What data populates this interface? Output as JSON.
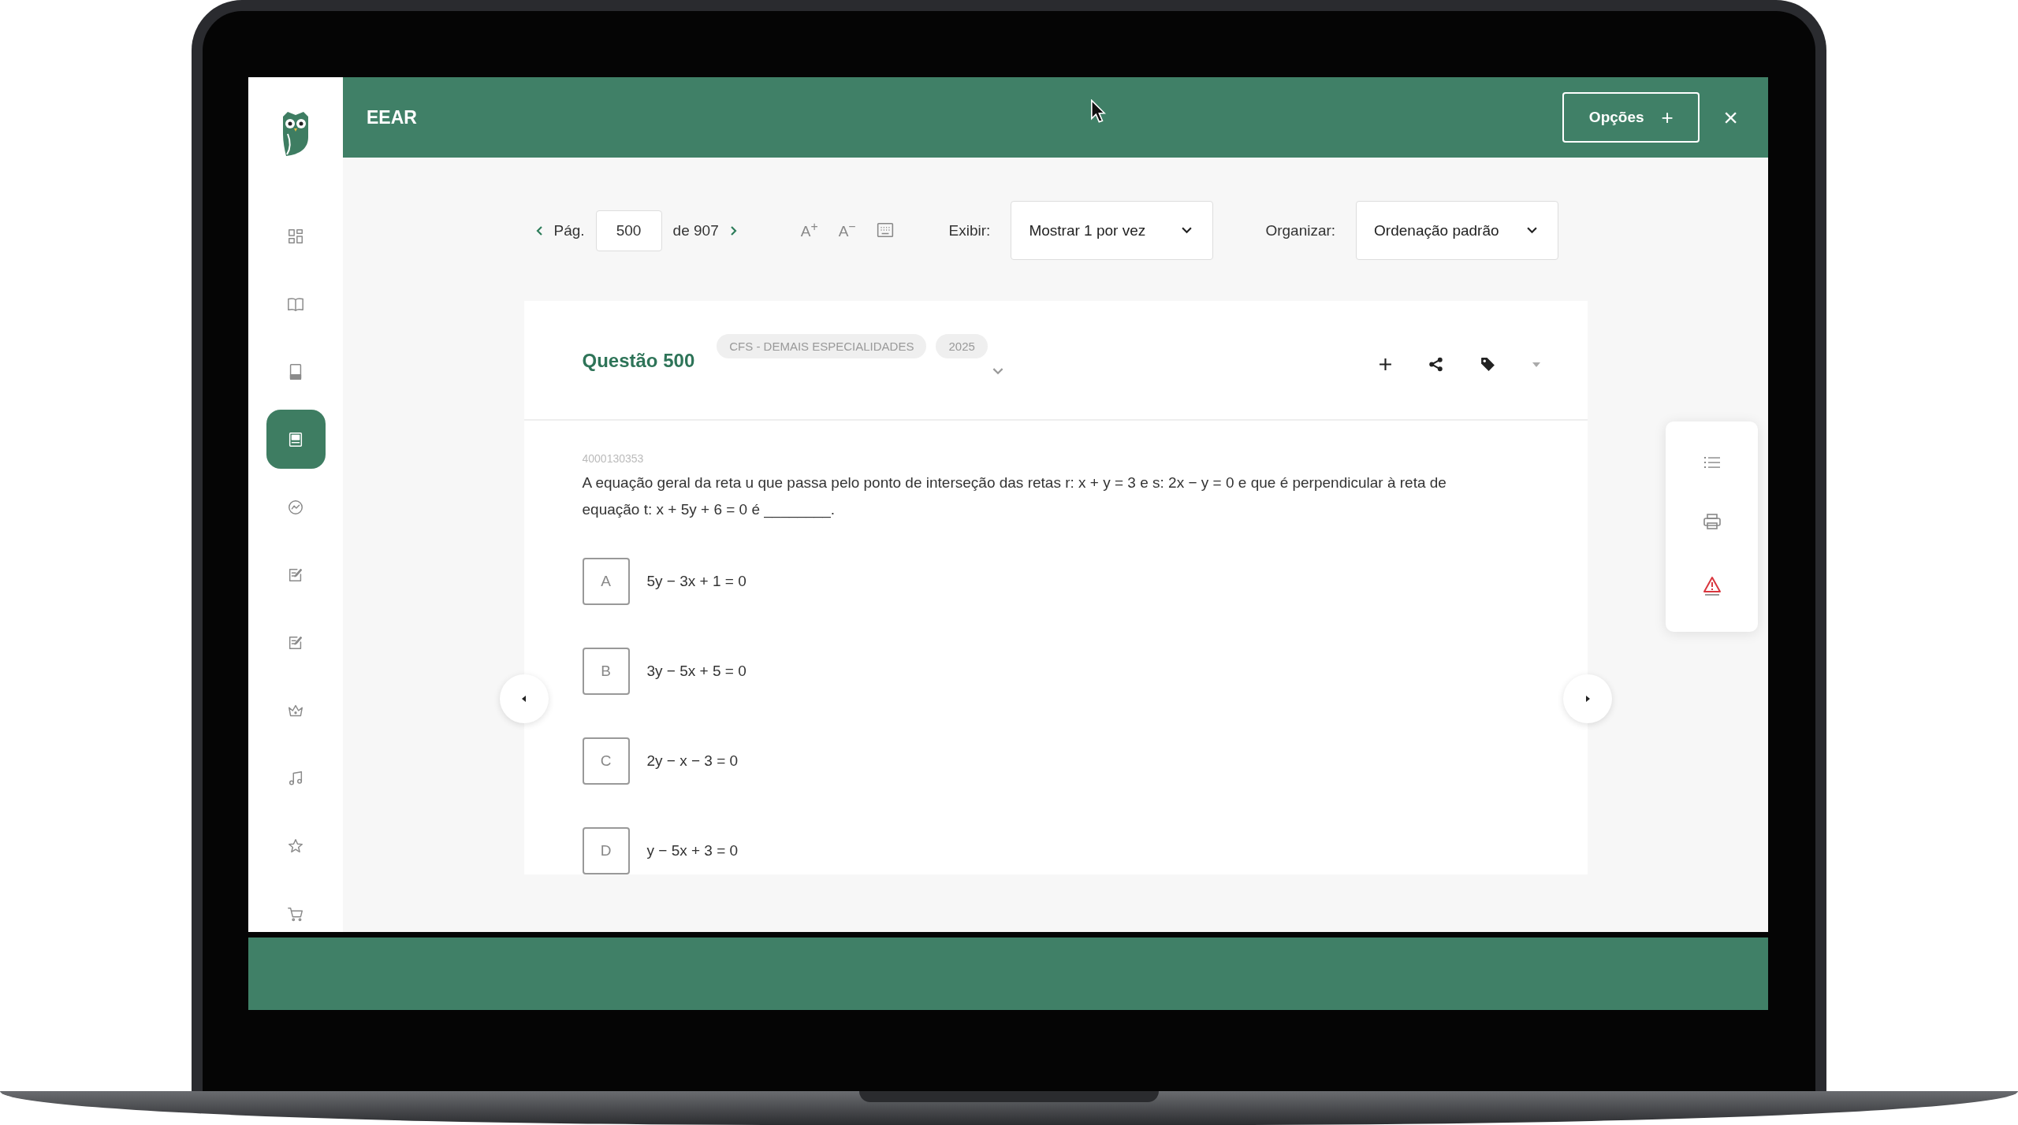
{
  "header": {
    "title": "EEAR",
    "options_button": "Opções",
    "options_icon": "+",
    "close_icon": "×"
  },
  "sidebar": {
    "items": [
      {
        "selected": false
      },
      {
        "selected": false
      },
      {
        "selected": false
      },
      {
        "selected": true
      },
      {
        "selected": false
      },
      {
        "selected": false
      },
      {
        "selected": false
      },
      {
        "selected": false
      },
      {
        "selected": false
      },
      {
        "selected": false
      },
      {
        "selected": false
      }
    ]
  },
  "toolbar": {
    "page_label": "Pág.",
    "page_value": "500",
    "page_total": "de 907",
    "font_increase": "A$^{+}$",
    "font_decrease": "A$^{−}$",
    "show_label": "Exibir:",
    "show_value": "Mostrar 1 por vez",
    "organize_label": "Organizar:",
    "organize_value": "Ordenação padrão"
  },
  "question": {
    "title": "Questão 500",
    "tags": [
      "CFS - DEMAIS ESPECIALIDADES",
      "2025"
    ],
    "code": "4000130353",
    "text": "A equação geral da reta u que passa pelo ponto de interseção das retas r: x + y = 3 e s: 2x − y = 0 e que é perpendicular à reta de equação t: x + 5y + 6 = 0 é ________.",
    "alternatives": [
      {
        "letter": "A",
        "text": "5y − 3x + 1 = 0"
      },
      {
        "letter": "B",
        "text": "3y − 5x + 5 = 0"
      },
      {
        "letter": "C",
        "text": "2y − x − 3 = 0"
      },
      {
        "letter": "D",
        "text": "y − 5x + 3 = 0"
      }
    ]
  }
}
